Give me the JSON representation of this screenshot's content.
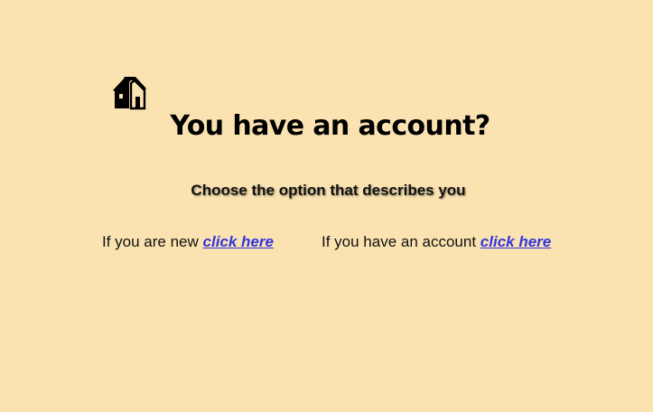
{
  "header": {
    "home_icon": "house-icon"
  },
  "main": {
    "title": "You have an account?",
    "subtitle": "Choose the option that describes you",
    "options": [
      {
        "prefix": "If you are new",
        "link_label": "click here"
      },
      {
        "prefix": "If you have an account",
        "link_label": "click here"
      }
    ]
  },
  "colors": {
    "background": "#fbe3b1",
    "link": "#3535e0",
    "text": "#111111"
  }
}
